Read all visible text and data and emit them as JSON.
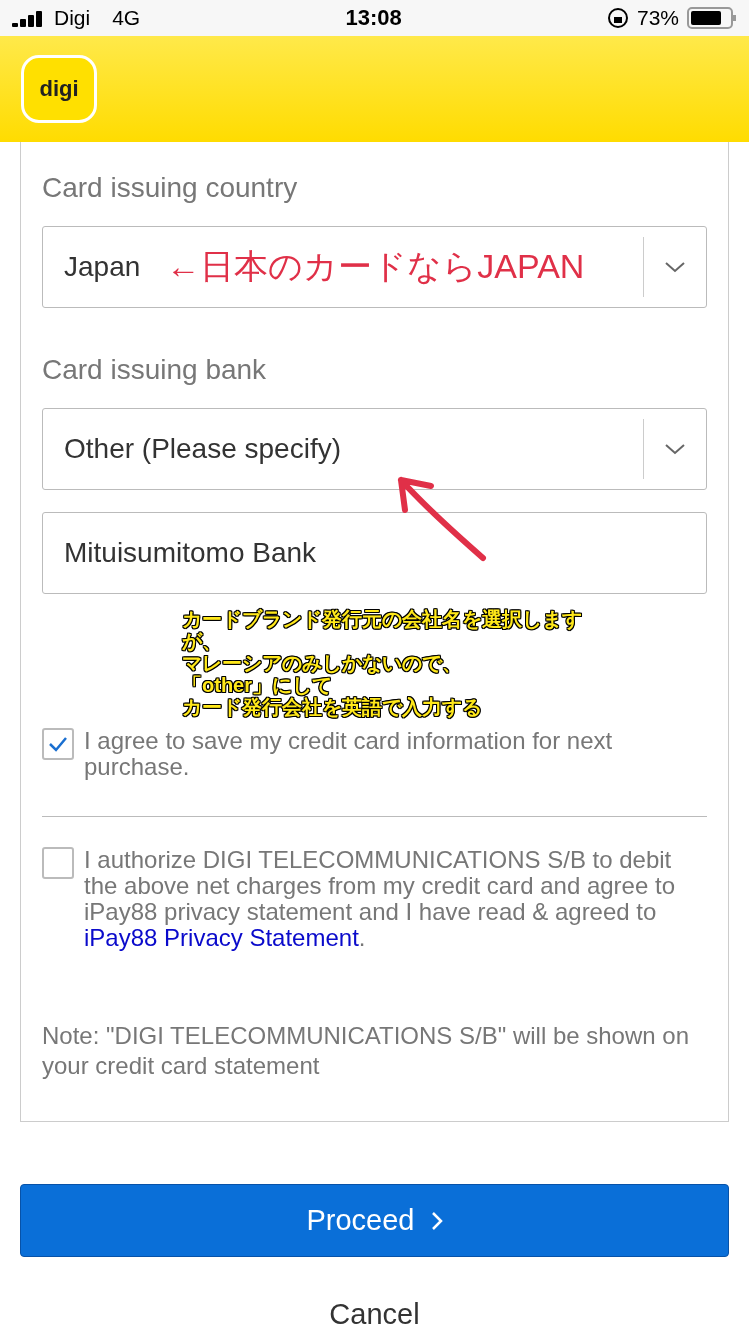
{
  "status_bar": {
    "carrier": "Digi",
    "network": "4G",
    "time": "13:08",
    "battery": "73%"
  },
  "header": {
    "logo": "digi"
  },
  "form": {
    "country": {
      "label": "Card issuing country",
      "value": "Japan",
      "annotation": "←日本のカードならJAPAN"
    },
    "bank": {
      "label": "Card issuing bank",
      "value": "Other (Please specify)",
      "specify_value": "Mituisumitomo Bank"
    },
    "annotation_lines": [
      "カードブランド発行元の会社名を選択します",
      "が、",
      "マレーシアのみしかないので、",
      "「other」にして",
      "カード発行会社を英語で入力する"
    ],
    "save_card": {
      "checked": true,
      "text": "I agree to save my credit card information for next purchase."
    },
    "authorize": {
      "checked": false,
      "text": "I authorize DIGI TELECOMMUNICATIONS S/B to debit the above net charges from my credit card and agree to iPay88 privacy statement and I have read & agreed to ",
      "link": "iPay88 Privacy Statement",
      "after": "."
    },
    "note": "Note: \"DIGI TELECOMMUNICATIONS S/B\" will be shown on your credit card statement"
  },
  "buttons": {
    "proceed": "Proceed",
    "cancel": "Cancel"
  }
}
